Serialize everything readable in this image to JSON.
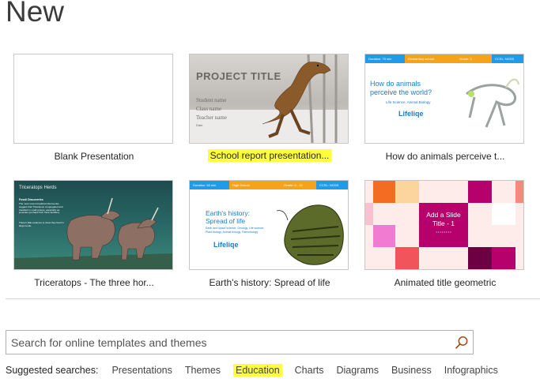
{
  "page": {
    "title": "New"
  },
  "templates": [
    {
      "label": "Blank Presentation"
    },
    {
      "label": "School report presentation...",
      "highlighted": true,
      "thumb": {
        "title": "PROJECT TITLE",
        "lines": [
          "Student name",
          "Class name",
          "Teacher name",
          "Date"
        ]
      }
    },
    {
      "label": "How do animals perceive t...",
      "thumb": {
        "bar": [
          "Duration: 75 min",
          "Elementary school",
          "Grade: 3",
          "CCSL: NGSS"
        ],
        "heading": "How do animals perceive the world?",
        "sub": "Life Science, Animal Biology",
        "logo": "Lifeliqe"
      }
    },
    {
      "label": "Triceratops - The three hor...",
      "thumb": {
        "heading": "Triceratops Herds",
        "section": "Fossil Discoveries",
        "body": "The most recent fossilized discoveries suggest that Triceratops congregated and travelled in small groups, especially as juveniles (perhaps from three families).",
        "body2": "There's little evidence to show they lived in large herds."
      }
    },
    {
      "label": "Earth's history: Spread of life",
      "thumb": {
        "bar": [
          "Duration: 50 min",
          "High School",
          "Grade: 9 - 12",
          "CCSL: NGSS"
        ],
        "heading": "Earth's history: Spread of life",
        "sub": "Earth and space science, Geology, Life science, Plant biology, Animal biology, Paleontology",
        "logo": "Lifeliqe"
      }
    },
    {
      "label": "Animated title geometric",
      "thumb": {
        "title": "Add a Slide Title - 1"
      }
    }
  ],
  "search": {
    "placeholder": "Search for online templates and themes"
  },
  "suggested": {
    "label": "Suggested searches:",
    "items": [
      "Presentations",
      "Themes",
      "Education",
      "Charts",
      "Diagrams",
      "Business",
      "Infographics"
    ],
    "highlighted": "Education"
  },
  "colors": {
    "bar_blue": "#1f9bea",
    "bar_orange": "#f7a21b",
    "lifeliqe_blue": "#1a7bd1",
    "magenta": "#b6006c",
    "orange": "#f26d21"
  }
}
